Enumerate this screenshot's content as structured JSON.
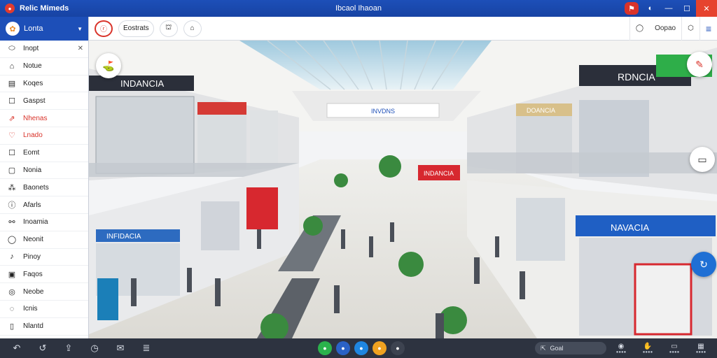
{
  "window": {
    "app_name": "Relic Mimeds",
    "title": "Ibcaol Ihaoan",
    "controls": [
      "⚑",
      "◐",
      "—",
      "☐",
      "✕"
    ]
  },
  "sidebar": {
    "header_label": "Lonta",
    "items": [
      {
        "icon": "pin-icon",
        "glyph": "⬭",
        "label": "Inopt",
        "closable": true
      },
      {
        "icon": "home-icon",
        "glyph": "⌂",
        "label": "Notue"
      },
      {
        "icon": "document-icon",
        "glyph": "▤",
        "label": "Koqes"
      },
      {
        "icon": "square-icon",
        "glyph": "☐",
        "label": "Gaspst"
      },
      {
        "icon": "chart-icon",
        "glyph": "⇗",
        "label": "Nhenas",
        "accent": true
      },
      {
        "icon": "heart-icon",
        "glyph": "♡",
        "label": "Lnado",
        "accent": true
      },
      {
        "icon": "box-icon",
        "glyph": "☐",
        "label": "Eomt"
      },
      {
        "icon": "page-icon",
        "glyph": "▢",
        "label": "Nonia"
      },
      {
        "icon": "cluster-icon",
        "glyph": "⁂",
        "label": "Baonets"
      },
      {
        "icon": "info-icon",
        "glyph": "ⓘ",
        "label": "Afarls"
      },
      {
        "icon": "link-icon",
        "glyph": "⚯",
        "label": "Inoamia"
      },
      {
        "icon": "chat-icon",
        "glyph": "◯",
        "label": "Neonit"
      },
      {
        "icon": "music-icon",
        "glyph": "♪",
        "label": "Pinoy"
      },
      {
        "icon": "grid-icon",
        "glyph": "▣",
        "label": "Faqos"
      },
      {
        "icon": "globe-icon",
        "glyph": "◎",
        "label": "Neobe"
      },
      {
        "icon": "lock-icon",
        "glyph": "◌",
        "label": "Icnis"
      },
      {
        "icon": "note-icon",
        "glyph": "▯",
        "label": "Nlantd"
      }
    ]
  },
  "toolbar": {
    "brand_glyph": "ⓡ",
    "tab_label": "Eostrats",
    "actions": [
      "⛫",
      "⌂"
    ],
    "right": [
      {
        "icon": "user-icon",
        "glyph": "◯"
      },
      {
        "icon": "profile-label",
        "label": "Oopao"
      },
      {
        "icon": "settings-icon",
        "glyph": "⬡"
      },
      {
        "icon": "menu-icon",
        "glyph": "≡"
      }
    ]
  },
  "scene": {
    "signs": [
      "INDANCIA",
      "RDNCIA",
      "INDANCIA",
      "INFIDACIA",
      "DOANCIA",
      "NAVACIA",
      "INVDNS"
    ],
    "fabs": [
      {
        "icon": "map-marker-icon",
        "glyph": "⛳"
      },
      {
        "icon": "edit-icon",
        "glyph": "✎"
      },
      {
        "icon": "screen-icon",
        "glyph": "▭"
      },
      {
        "icon": "refresh-icon",
        "glyph": "↻"
      }
    ]
  },
  "bottombar": {
    "left_icons": [
      {
        "icon": "back-icon",
        "glyph": "↶"
      },
      {
        "icon": "refresh-icon",
        "glyph": "↺"
      },
      {
        "icon": "share-icon",
        "glyph": "⇪"
      },
      {
        "icon": "history-icon",
        "glyph": "◷"
      },
      {
        "icon": "message-icon",
        "glyph": "✉"
      },
      {
        "icon": "list-icon",
        "glyph": "≣"
      }
    ],
    "dots": [
      {
        "color": "#2bb24c",
        "glyph": "●"
      },
      {
        "color": "#2a62c6",
        "glyph": "●"
      },
      {
        "color": "#1f86e0",
        "glyph": "●"
      },
      {
        "color": "#f0a220",
        "glyph": "●"
      },
      {
        "color": "#3d4350",
        "glyph": "●"
      }
    ],
    "search_icon": "⇱",
    "search_text": "Goal",
    "right": [
      {
        "icon": "camera-icon",
        "glyph": "◉",
        "label": "●●●●"
      },
      {
        "icon": "hand-icon",
        "glyph": "✋",
        "label": "●●●●"
      },
      {
        "icon": "screen-icon",
        "glyph": "▭",
        "label": "●●●●"
      },
      {
        "icon": "tag-icon",
        "glyph": "▦",
        "label": "●●●●"
      }
    ]
  }
}
